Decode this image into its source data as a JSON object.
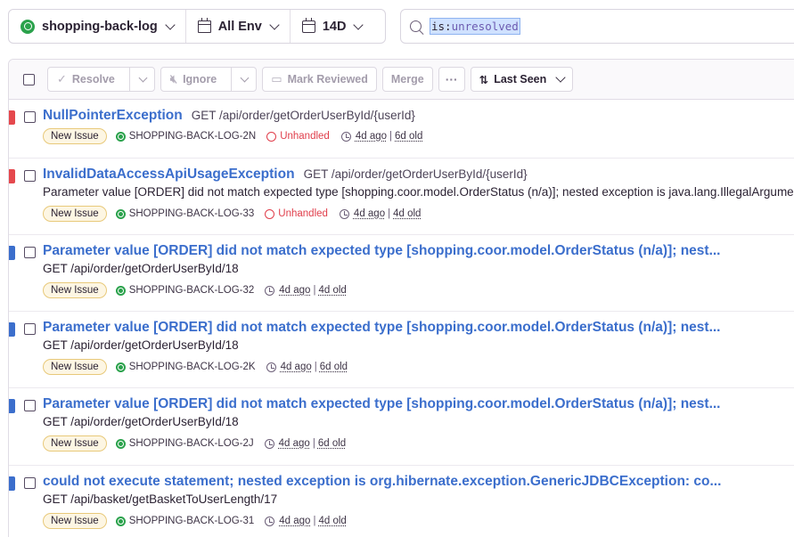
{
  "filters": {
    "project": "shopping-back-log",
    "environment": "All Env",
    "period": "14D"
  },
  "search": {
    "query_key": "is:",
    "query_value": "unresolved"
  },
  "toolbar": {
    "resolve": "Resolve",
    "ignore": "Ignore",
    "mark_reviewed": "Mark Reviewed",
    "merge": "Merge",
    "more": "···",
    "sort": "Last Seen"
  },
  "colors": {
    "high_priority": "#e5484d",
    "medium_priority": "#3b6ecc"
  },
  "issues": [
    {
      "title": "NullPointerException",
      "location": "GET /api/order/getOrderUserById/{userId}",
      "message": "",
      "status": "New Issue",
      "short_id": "SHOPPING-BACK-LOG-2N",
      "unhandled": "Unhandled",
      "last_seen": "4d ago",
      "first_seen": "6d old",
      "priority": "high"
    },
    {
      "title": "InvalidDataAccessApiUsageException",
      "location": "GET /api/order/getOrderUserById/{userId}",
      "message": "Parameter value [ORDER] did not match expected type [shopping.coor.model.OrderStatus (n/a)]; nested exception is java.lang.IllegalArgumentException",
      "status": "New Issue",
      "short_id": "SHOPPING-BACK-LOG-33",
      "unhandled": "Unhandled",
      "last_seen": "4d ago",
      "first_seen": "4d old",
      "priority": "high"
    },
    {
      "title": "Parameter value [ORDER] did not match expected type [shopping.coor.model.OrderStatus (n/a)]; nest...",
      "location": "",
      "message": "GET /api/order/getOrderUserById/18",
      "status": "New Issue",
      "short_id": "SHOPPING-BACK-LOG-32",
      "unhandled": "",
      "last_seen": "4d ago",
      "first_seen": "4d old",
      "priority": "medium"
    },
    {
      "title": "Parameter value [ORDER] did not match expected type [shopping.coor.model.OrderStatus (n/a)]; nest...",
      "location": "",
      "message": "GET /api/order/getOrderUserById/18",
      "status": "New Issue",
      "short_id": "SHOPPING-BACK-LOG-2K",
      "unhandled": "",
      "last_seen": "4d ago",
      "first_seen": "6d old",
      "priority": "medium"
    },
    {
      "title": "Parameter value [ORDER] did not match expected type [shopping.coor.model.OrderStatus (n/a)]; nest...",
      "location": "",
      "message": "GET /api/order/getOrderUserById/18",
      "status": "New Issue",
      "short_id": "SHOPPING-BACK-LOG-2J",
      "unhandled": "",
      "last_seen": "4d ago",
      "first_seen": "6d old",
      "priority": "medium"
    },
    {
      "title": "could not execute statement; nested exception is org.hibernate.exception.GenericJDBCException: co...",
      "location": "",
      "message": "GET /api/basket/getBasketToUserLength/17",
      "status": "New Issue",
      "short_id": "SHOPPING-BACK-LOG-31",
      "unhandled": "",
      "last_seen": "4d ago",
      "first_seen": "4d old",
      "priority": "medium"
    }
  ]
}
